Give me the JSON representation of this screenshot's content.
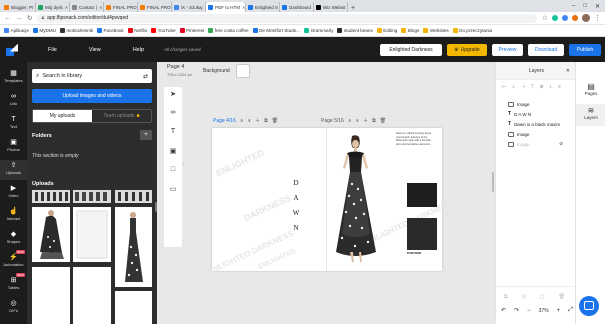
{
  "tabs": [
    {
      "label": "Blogger: Pr",
      "color": "#f57d00"
    },
    {
      "label": "Mój dysk",
      "color": "#1fa463"
    },
    {
      "label": "Contact |",
      "color": "#888888"
    },
    {
      "label": "FINAL PRO",
      "color": "#f57d00"
    },
    {
      "label": "FINAL PRO",
      "color": "#f57d00"
    },
    {
      "label": "iX - Szukaj",
      "color": "#4285f4"
    },
    {
      "label": "PDF to HTM",
      "color": "#1a73e8",
      "active": true
    },
    {
      "label": "Enlighted S",
      "color": "#1a73e8"
    },
    {
      "label": "Dashboard",
      "color": "#1a73e8"
    },
    {
      "label": "Wix Websit",
      "color": "#000000"
    }
  ],
  "address": {
    "url": "app.flipsnack.com/editor/dul4pvvqed"
  },
  "bookmarks": [
    {
      "label": "Aplikacje",
      "color": "#4285f4"
    },
    {
      "label": "MyDMU",
      "color": "#1a73e8"
    },
    {
      "label": "mobiozlesnik",
      "color": "#333333"
    },
    {
      "label": "Facebook",
      "color": "#1877f2"
    },
    {
      "label": "Netflix",
      "color": "#e50914"
    },
    {
      "label": "YouTube",
      "color": "#ff0000"
    },
    {
      "label": "Pinterest",
      "color": "#e60023"
    },
    {
      "label": "free costa coffee",
      "color": "#34a853"
    },
    {
      "label": "De Montfort Stude...",
      "color": "#1a73e8"
    },
    {
      "label": "Grammarly",
      "color": "#15c39a"
    },
    {
      "label": "student beans",
      "color": "#2a2a2a"
    },
    {
      "label": "Editing",
      "color": "#f4b400"
    },
    {
      "label": "Blogs",
      "color": "#f4b400"
    },
    {
      "label": "Websites",
      "color": "#f4b400"
    },
    {
      "label": "Do przeczytania",
      "color": "#f4b400"
    }
  ],
  "app_header": {
    "menu": [
      "File",
      "View",
      "Help"
    ],
    "save_status": "All changes saved",
    "title": "Enlighted Darkness",
    "upgrade": "Upgrade",
    "preview": "Preview",
    "download": "Download",
    "publish": "Publish"
  },
  "sidebar": [
    {
      "label": "Templates",
      "glyph": "▦"
    },
    {
      "label": "Link",
      "glyph": "∞"
    },
    {
      "label": "Text",
      "glyph": "T"
    },
    {
      "label": "Photos",
      "glyph": "▣"
    },
    {
      "label": "Uploads",
      "glyph": "⇪",
      "active": true
    },
    {
      "label": "Video",
      "glyph": "▶"
    },
    {
      "label": "Interact",
      "glyph": "☝"
    },
    {
      "label": "Shapes",
      "glyph": "◆"
    },
    {
      "label": "Automation",
      "glyph": "⚡",
      "new": "NEW"
    },
    {
      "label": "Tables",
      "glyph": "⊞",
      "new": "NEW"
    },
    {
      "label": "GIFs",
      "glyph": "◎"
    }
  ],
  "uploads_panel": {
    "search_placeholder": "Search in library",
    "upload_button": "Upload images and videos",
    "tab_my": "My uploads",
    "tab_team": "Team uploads",
    "folders_title": "Folders",
    "empty_text": "This section is empty",
    "uploads_title": "Uploads"
  },
  "canvas": {
    "page_label": "Page 4",
    "page_size": "795 x 1124 px",
    "background_label": "Background",
    "left_page": "Page 4/16",
    "right_page": "Page 5/16",
    "dawn_letters": [
      "D",
      "A",
      "W",
      "N"
    ],
    "watermarks": [
      "ENLIGHTED",
      "DARKNESS",
      "ENLIGHTED DARKNESS",
      "ENLIGHTED DARKNESS",
      "ENLIGHTED"
    ],
    "description": "Dawn is a black evening dress, maxi length, features of the Bohemian style with a full tulle skirt and decorative elements.",
    "swatch_label": "PANTONE"
  },
  "layers_panel": {
    "title": "Layers",
    "items": [
      {
        "icon": "image",
        "label": "Image"
      },
      {
        "icon": "text",
        "label": "D A W N"
      },
      {
        "icon": "text",
        "label": "Dawn is a black maxim"
      },
      {
        "icon": "image",
        "label": "Image"
      },
      {
        "icon": "image",
        "label": "Image",
        "hidden": true
      }
    ],
    "zoom": "37%"
  },
  "right_rail": [
    {
      "label": "Pages",
      "glyph": "▤"
    },
    {
      "label": "Layers",
      "glyph": "≋",
      "active": true
    }
  ]
}
